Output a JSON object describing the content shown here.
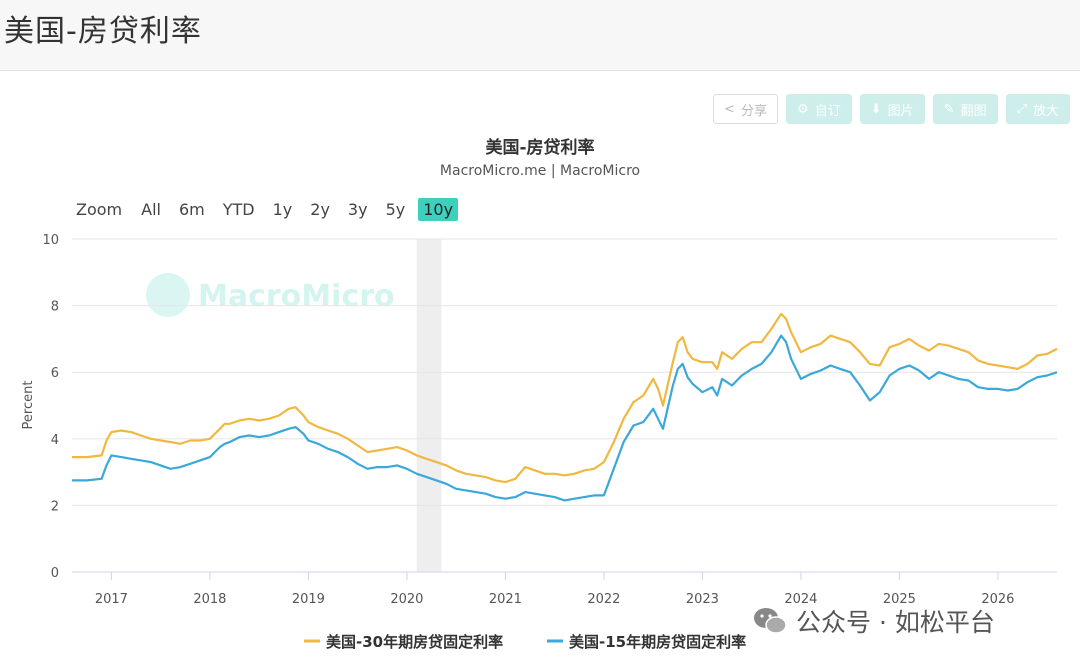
{
  "page_title": "美国-房贷利率",
  "toolbar": {
    "share": "分享",
    "custom": "自订",
    "image": "图片",
    "draw": "翻图",
    "enlarge": "放大"
  },
  "zoom": {
    "label": "Zoom",
    "options": [
      "All",
      "6m",
      "YTD",
      "1y",
      "2y",
      "3y",
      "5y",
      "10y"
    ],
    "active": "10y"
  },
  "watermark": "MacroMicro",
  "footer_watermark": "公众号 · 如松平台",
  "colors": {
    "series30": "#f0b840",
    "series15": "#3aa8d8",
    "accent": "#3fd0bd",
    "recession": "#eeeeee"
  },
  "chart_data": {
    "type": "line",
    "title": "美国-房贷利率",
    "subtitle": "MacroMicro.me | MacroMicro",
    "ylabel": "Percent",
    "xlabel": "",
    "ylim": [
      0,
      10
    ],
    "yticks": [
      0,
      2,
      4,
      6,
      8,
      10
    ],
    "xlim": [
      2016.6,
      2026.6
    ],
    "xticks": [
      2017,
      2018,
      2019,
      2020,
      2021,
      2022,
      2023,
      2024,
      2025,
      2026
    ],
    "grid": true,
    "legend": "bottom",
    "shaded_period": [
      2020.1,
      2020.35
    ],
    "series": [
      {
        "name": "美国-30年期房贷固定利率",
        "x": [
          2016.6,
          2016.75,
          2016.9,
          2016.95,
          2017.0,
          2017.1,
          2017.2,
          2017.3,
          2017.4,
          2017.5,
          2017.6,
          2017.7,
          2017.8,
          2017.9,
          2018.0,
          2018.1,
          2018.15,
          2018.2,
          2018.3,
          2018.4,
          2018.5,
          2018.6,
          2018.7,
          2018.8,
          2018.87,
          2018.95,
          2019.0,
          2019.1,
          2019.2,
          2019.3,
          2019.4,
          2019.5,
          2019.6,
          2019.7,
          2019.8,
          2019.9,
          2020.0,
          2020.1,
          2020.2,
          2020.3,
          2020.4,
          2020.5,
          2020.6,
          2020.7,
          2020.8,
          2020.9,
          2021.0,
          2021.1,
          2021.2,
          2021.3,
          2021.4,
          2021.5,
          2021.6,
          2021.7,
          2021.8,
          2021.9,
          2022.0,
          2022.1,
          2022.2,
          2022.3,
          2022.4,
          2022.5,
          2022.55,
          2022.6,
          2022.7,
          2022.75,
          2022.8,
          2022.85,
          2022.9,
          2023.0,
          2023.1,
          2023.15,
          2023.2,
          2023.3,
          2023.4,
          2023.5,
          2023.6,
          2023.7,
          2023.8,
          2023.85,
          2023.9,
          2024.0,
          2024.1,
          2024.2,
          2024.3,
          2024.4,
          2024.5,
          2024.6,
          2024.7,
          2024.8,
          2024.9,
          2025.0,
          2025.1,
          2025.2,
          2025.3,
          2025.4,
          2025.5,
          2025.6,
          2025.7,
          2025.8,
          2025.9,
          2026.0,
          2026.1,
          2026.2,
          2026.3,
          2026.4,
          2026.5,
          2026.6
        ],
        "values": [
          3.45,
          3.45,
          3.5,
          3.95,
          4.2,
          4.25,
          4.2,
          4.1,
          4.0,
          3.95,
          3.9,
          3.85,
          3.95,
          3.95,
          4.0,
          4.3,
          4.45,
          4.45,
          4.55,
          4.6,
          4.55,
          4.6,
          4.7,
          4.9,
          4.95,
          4.7,
          4.5,
          4.35,
          4.25,
          4.15,
          4.0,
          3.8,
          3.6,
          3.65,
          3.7,
          3.75,
          3.65,
          3.5,
          3.4,
          3.3,
          3.2,
          3.05,
          2.95,
          2.9,
          2.85,
          2.75,
          2.7,
          2.8,
          3.15,
          3.05,
          2.95,
          2.95,
          2.9,
          2.95,
          3.05,
          3.1,
          3.3,
          3.9,
          4.6,
          5.1,
          5.3,
          5.8,
          5.5,
          5.0,
          6.3,
          6.9,
          7.05,
          6.6,
          6.4,
          6.3,
          6.3,
          6.1,
          6.6,
          6.4,
          6.7,
          6.9,
          6.9,
          7.3,
          7.75,
          7.6,
          7.2,
          6.6,
          6.75,
          6.85,
          7.1,
          7.0,
          6.9,
          6.6,
          6.25,
          6.2,
          6.75,
          6.85,
          7.0,
          6.8,
          6.65,
          6.85,
          6.8,
          6.7,
          6.6,
          6.35,
          6.25,
          6.2,
          6.15,
          6.1,
          6.25,
          6.5,
          6.55,
          6.7
        ]
      },
      {
        "name": "美国-15年期房贷固定利率",
        "x": [
          2016.6,
          2016.75,
          2016.9,
          2016.95,
          2017.0,
          2017.1,
          2017.2,
          2017.3,
          2017.4,
          2017.5,
          2017.6,
          2017.7,
          2017.8,
          2017.9,
          2018.0,
          2018.1,
          2018.15,
          2018.2,
          2018.3,
          2018.4,
          2018.5,
          2018.6,
          2018.7,
          2018.8,
          2018.87,
          2018.95,
          2019.0,
          2019.1,
          2019.2,
          2019.3,
          2019.4,
          2019.5,
          2019.6,
          2019.7,
          2019.8,
          2019.9,
          2020.0,
          2020.1,
          2020.2,
          2020.3,
          2020.4,
          2020.5,
          2020.6,
          2020.7,
          2020.8,
          2020.9,
          2021.0,
          2021.1,
          2021.2,
          2021.3,
          2021.4,
          2021.5,
          2021.6,
          2021.7,
          2021.8,
          2021.9,
          2022.0,
          2022.1,
          2022.2,
          2022.3,
          2022.4,
          2022.5,
          2022.55,
          2022.6,
          2022.7,
          2022.75,
          2022.8,
          2022.85,
          2022.9,
          2023.0,
          2023.1,
          2023.15,
          2023.2,
          2023.3,
          2023.4,
          2023.5,
          2023.6,
          2023.7,
          2023.8,
          2023.85,
          2023.9,
          2024.0,
          2024.1,
          2024.2,
          2024.3,
          2024.4,
          2024.5,
          2024.6,
          2024.7,
          2024.8,
          2024.9,
          2025.0,
          2025.1,
          2025.2,
          2025.3,
          2025.4,
          2025.5,
          2025.6,
          2025.7,
          2025.8,
          2025.9,
          2026.0,
          2026.1,
          2026.2,
          2026.3,
          2026.4,
          2026.5,
          2026.6
        ],
        "values": [
          2.75,
          2.75,
          2.8,
          3.2,
          3.5,
          3.45,
          3.4,
          3.35,
          3.3,
          3.2,
          3.1,
          3.15,
          3.25,
          3.35,
          3.45,
          3.75,
          3.85,
          3.9,
          4.05,
          4.1,
          4.05,
          4.1,
          4.2,
          4.3,
          4.35,
          4.15,
          3.95,
          3.85,
          3.7,
          3.6,
          3.45,
          3.25,
          3.1,
          3.15,
          3.15,
          3.2,
          3.1,
          2.95,
          2.85,
          2.75,
          2.65,
          2.5,
          2.45,
          2.4,
          2.35,
          2.25,
          2.2,
          2.25,
          2.4,
          2.35,
          2.3,
          2.25,
          2.15,
          2.2,
          2.25,
          2.3,
          2.3,
          3.1,
          3.9,
          4.4,
          4.5,
          4.9,
          4.6,
          4.3,
          5.6,
          6.1,
          6.25,
          5.85,
          5.65,
          5.4,
          5.55,
          5.3,
          5.8,
          5.6,
          5.9,
          6.1,
          6.25,
          6.6,
          7.1,
          6.9,
          6.4,
          5.8,
          5.95,
          6.05,
          6.2,
          6.1,
          6.0,
          5.6,
          5.15,
          5.4,
          5.9,
          6.1,
          6.2,
          6.05,
          5.8,
          6.0,
          5.9,
          5.8,
          5.75,
          5.55,
          5.5,
          5.5,
          5.45,
          5.5,
          5.7,
          5.85,
          5.9,
          6.0
        ]
      }
    ]
  }
}
